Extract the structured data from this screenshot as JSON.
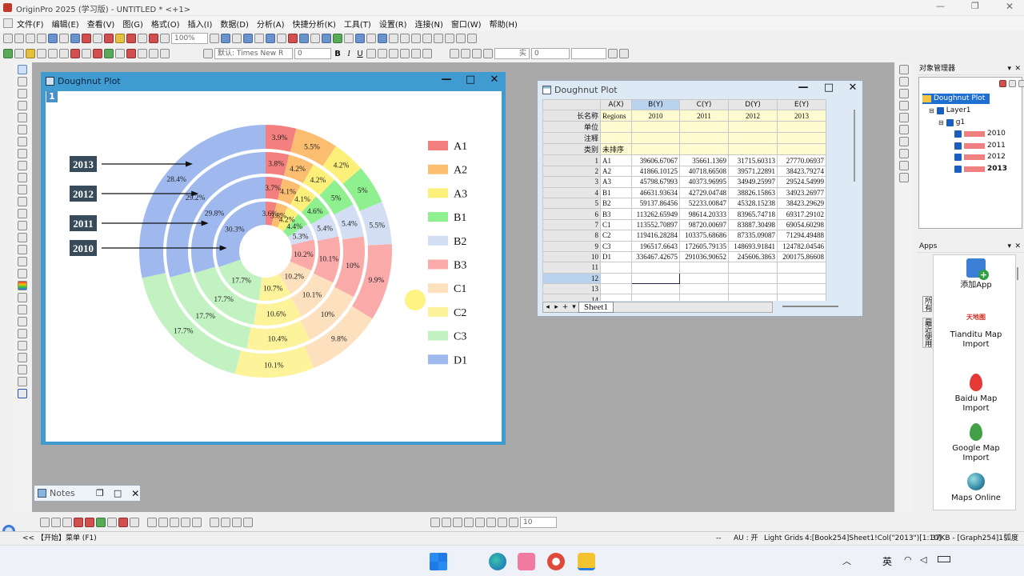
{
  "app": {
    "title": "OriginPro 2025 (学习版) - UNTITLED * <+1>"
  },
  "menu": [
    "文件(F)",
    "编辑(E)",
    "查看(V)",
    "图(G)",
    "格式(O)",
    "插入(I)",
    "数据(D)",
    "分析(A)",
    "快捷分析(K)",
    "工具(T)",
    "设置(R)",
    "连接(N)",
    "窗口(W)",
    "帮助(H)"
  ],
  "toolbar": {
    "zoom": "100%",
    "font": "默认: Times New R",
    "font_size": "0",
    "bold": "B",
    "italic": "I",
    "underline": "U",
    "line_width": "0",
    "line_style": "实"
  },
  "graph_window": {
    "title": "Doughnut Plot",
    "layer_badge": "1",
    "year_labels": [
      "2013",
      "2012",
      "2011",
      "2010"
    ],
    "legend": [
      {
        "label": "A1",
        "color": "#f47f7f"
      },
      {
        "label": "A2",
        "color": "#fbbd6f"
      },
      {
        "label": "A3",
        "color": "#fdf07a"
      },
      {
        "label": "B1",
        "color": "#8ff08f"
      },
      {
        "label": "B2",
        "color": "#d3def5"
      },
      {
        "label": "B3",
        "color": "#fbaaaa"
      },
      {
        "label": "C1",
        "color": "#fde1bf"
      },
      {
        "label": "C2",
        "color": "#fdf39a"
      },
      {
        "label": "C3",
        "color": "#c2f1c2"
      },
      {
        "label": "D1",
        "color": "#9fb9ef"
      }
    ]
  },
  "chart_data": {
    "type": "pie",
    "subtype": "doughnut",
    "categories": [
      "A1",
      "A2",
      "A3",
      "B1",
      "B2",
      "B3",
      "C1",
      "C2",
      "C3",
      "D1"
    ],
    "series": [
      {
        "name": "2010",
        "labels": [
          "3.6%",
          "3.8%",
          "4.2%",
          "4.4%",
          "5.3%",
          "10.2%",
          "10.2%",
          "10.7%",
          "17.7%",
          "30.3%"
        ],
        "values": [
          3.6,
          3.8,
          4.2,
          4.4,
          5.3,
          10.2,
          10.2,
          10.7,
          17.7,
          30.3
        ]
      },
      {
        "name": "2011",
        "labels": [
          "3.7%",
          "4.1%",
          "4.1%",
          "4.6%",
          "5.4%",
          "10.1%",
          "10.1%",
          "10.6%",
          "17.7%",
          "29.8%"
        ],
        "values": [
          3.7,
          4.1,
          4.1,
          4.6,
          5.4,
          10.1,
          10.1,
          10.6,
          17.7,
          29.8
        ]
      },
      {
        "name": "2012",
        "labels": [
          "3.8%",
          "4.2%",
          "4.2%",
          "5%",
          "5.4%",
          "10%",
          "10%",
          "10.4%",
          "17.7%",
          "29.2%"
        ],
        "values": [
          3.8,
          4.2,
          4.2,
          5,
          5.4,
          10,
          10,
          10.4,
          17.7,
          29.2
        ]
      },
      {
        "name": "2013",
        "labels": [
          "3.9%",
          "5.5%",
          "4.2%",
          "5%",
          "5.5%",
          "9.9%",
          "9.8%",
          "10.1%",
          "17.7%",
          "28.4%"
        ],
        "values": [
          3.9,
          5.5,
          4.2,
          5,
          5.5,
          9.9,
          9.8,
          10.1,
          17.7,
          28.4
        ]
      }
    ],
    "legend_position": "right"
  },
  "workbook": {
    "title": "Doughnut Plot",
    "columns": [
      "A(X)",
      "B(Y)",
      "C(Y)",
      "D(Y)",
      "E(Y)"
    ],
    "meta_rows": [
      {
        "label": "长名称",
        "cells": [
          "Regions",
          "2010",
          "2011",
          "2012",
          "2013"
        ]
      },
      {
        "label": "单位",
        "cells": [
          "",
          "",
          "",
          "",
          ""
        ]
      },
      {
        "label": "注释",
        "cells": [
          "",
          "",
          "",
          "",
          ""
        ]
      },
      {
        "label": "类别",
        "cells": [
          "未排序",
          "",
          "",
          "",
          ""
        ]
      }
    ],
    "rows": [
      [
        "1",
        "A1",
        "39606.67067",
        "35661.1369",
        "31715.60313",
        "27770.06937"
      ],
      [
        "2",
        "A2",
        "41866.10125",
        "40718.66508",
        "39571.22891",
        "38423.79274"
      ],
      [
        "3",
        "A3",
        "45798.67993",
        "40373.96995",
        "34949.25997",
        "29524.54999"
      ],
      [
        "4",
        "B1",
        "46631.93634",
        "42729.04748",
        "38826.15863",
        "34923.26977"
      ],
      [
        "5",
        "B2",
        "59137.86456",
        "52233.00847",
        "45328.15238",
        "38423.29629"
      ],
      [
        "6",
        "B3",
        "113262.65949",
        "98614.20333",
        "83965.74718",
        "69317.29102"
      ],
      [
        "7",
        "C1",
        "113552.70897",
        "98720.00697",
        "83887.30498",
        "69054.60298"
      ],
      [
        "8",
        "C2",
        "119416.28284",
        "103375.68686",
        "87335.09087",
        "71294.49488"
      ],
      [
        "9",
        "C3",
        "196517.6643",
        "172605.79135",
        "148693.91841",
        "124782.04546"
      ],
      [
        "10",
        "D1",
        "336467.42675",
        "291036.90652",
        "245606.3863",
        "200175.86608"
      ],
      [
        "11",
        "",
        "",
        "",
        "",
        ""
      ],
      [
        "12",
        "",
        "",
        "",
        "",
        ""
      ],
      [
        "13",
        "",
        "",
        "",
        "",
        ""
      ],
      [
        "14",
        "",
        "",
        "",
        "",
        ""
      ]
    ],
    "sheet_tab": "Sheet1"
  },
  "object_manager": {
    "title": "对象管理器",
    "root": "Doughnut Plot",
    "layer": "Layer1",
    "group": "g1",
    "plots": [
      "2010",
      "2011",
      "2012",
      "2013"
    ]
  },
  "apps_panel": {
    "title": "Apps",
    "items": [
      "添加App",
      "Tianditu Map Import",
      "Baidu Map Import",
      "Google Map Import",
      "Maps Online"
    ],
    "tianditu_logo": "天地图",
    "side_tabs": [
      "所有",
      "最近使用"
    ]
  },
  "notes": {
    "title": "Notes"
  },
  "statusbar": {
    "left": "<< 【开始】菜单 (F1)",
    "au": "AU : 开",
    "grids": "Light Grids",
    "book": "4:[Book254]Sheet1!Col(\"2013\")[1:10]",
    "mem": "37KB - [Graph254]1!",
    "unit": "弧度",
    "dash": "--"
  },
  "bottom_toolbar": {
    "size": "10"
  },
  "taskbar": {
    "ime": "英"
  }
}
